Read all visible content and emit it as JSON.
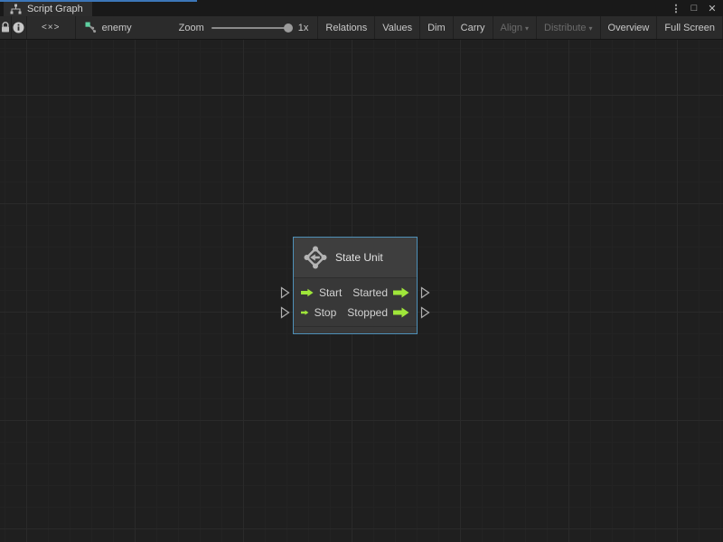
{
  "tab": {
    "title": "Script Graph",
    "icon": "graph-hierarchy-icon"
  },
  "window_controls": {
    "menu": "⋮",
    "maximize": "□",
    "close": "✕"
  },
  "toolbar": {
    "lock_icon": "lock-icon",
    "info_icon": "info-icon",
    "code_icon_text": "<×>",
    "graph_icon": "flow-graph-icon",
    "graph_name": "enemy",
    "zoom_label": "Zoom",
    "zoom_value": "1x",
    "buttons": [
      {
        "label": "Relations",
        "enabled": true
      },
      {
        "label": "Values",
        "enabled": true
      },
      {
        "label": "Dim",
        "enabled": true
      },
      {
        "label": "Carry",
        "enabled": true
      },
      {
        "label": "Align",
        "enabled": false,
        "caret": "▾"
      },
      {
        "label": "Distribute",
        "enabled": false,
        "caret": "▾"
      },
      {
        "label": "Overview",
        "enabled": true
      },
      {
        "label": "Full Screen",
        "enabled": true
      }
    ]
  },
  "node": {
    "title": "State Unit",
    "icon": "state-machine-icon",
    "rows": [
      {
        "input": "Start",
        "output": "Started"
      },
      {
        "input": "Stop",
        "output": "Stopped"
      }
    ]
  },
  "colors": {
    "accent_blue": "#3c76b8",
    "node_border": "#4e90b8",
    "port_green": "#9fe63a",
    "graph_icon_teal": "#5ecfa0"
  }
}
